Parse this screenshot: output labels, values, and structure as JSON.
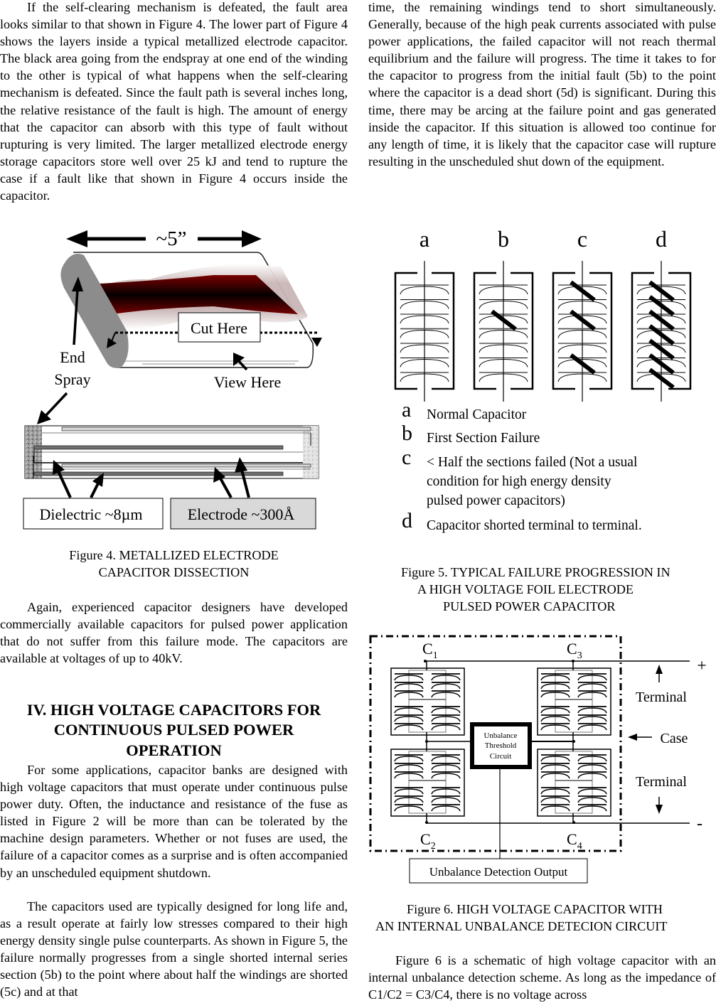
{
  "left_column": {
    "para_1": "If the self-clearing mechanism is defeated, the fault area looks similar to that shown in Figure 4. The lower part of Figure 4 shows the layers inside a typical metallized electrode capacitor.   The black area going from the endspray at one end of the winding to the other is typical of what happens when the self-clearing mechanism is defeated.   Since the fault path is several inches long, the relative resistance of the fault is high. The amount of energy that the capacitor can absorb with this type of fault without rupturing is very limited.   The larger metallized electrode energy storage capacitors store well over 25 kJ and tend to rupture the case if a fault like that shown in Figure 4 occurs inside the capacitor.",
    "para_2": "Again, experienced capacitor designers have developed commercially available capacitors for pulsed power application that do not suffer from this failure mode. The capacitors are available at voltages of up to 40kV.",
    "section_heading_line1": "IV. HIGH VOLTAGE CAPACITORS  FOR",
    "section_heading_line2": "CONTINUOUS PULSED POWER",
    "section_heading_line3": "OPERATION",
    "para_3": "For some applications, capacitor banks are designed with high voltage capacitors that must operate under continuous pulse power duty.   Often, the inductance and resistance of the fuse as listed in Figure 2 will be more than can be tolerated by the machine design parameters. Whether or not fuses are used, the failure of a capacitor comes as a surprise and is often accompanied by an unscheduled equipment shutdown.",
    "para_4": "The capacitors used are typically designed for long life and, as a result operate at fairly low stresses compared to their high energy density single pulse counterparts.   As shown in Figure 5, the failure normally progresses from a single shorted internal series section (5b) to the point where about half the windings are shorted (5c) and at that"
  },
  "figure_4": {
    "length_label": "~5”",
    "cut_label": "Cut Here",
    "end_spray_line1": "End",
    "end_spray_line2": "Spray",
    "view_label": "View Here",
    "dielectric_label": "Dielectric ~8µm",
    "electrode_label": "Electrode ~300Å",
    "caption_line1": "Figure 4.  METALLIZED ELECTRODE",
    "caption_line2": "CAPACITOR DISSECTION",
    "colors": {
      "fault": "#7a0000",
      "endspray": "#8c8c8c",
      "electrode_box": "#d9d9d9"
    }
  },
  "right_column": {
    "para_1": "time, the remaining windings tend to short simultaneously. Generally, because of the high peak currents associated with pulse power applications, the failed capacitor will not reach thermal equilibrium and the failure will progress. The time it takes to for the capacitor to progress from the initial fault (5b) to the point where the capacitor is a dead short (5d) is significant.  During this time, there may be arcing at the failure point and gas generated inside the capacitor.   If this situation is allowed too continue for any length of time, it is likely that the capacitor case will rupture resulting in the unscheduled shut down of the equipment.",
    "para_2": "Figure 6 is a schematic of high voltage capacitor with an internal unbalance detection scheme.   As long as the impedance of C1/C2 = C3/C4, there is no voltage across"
  },
  "figure_5": {
    "panels": [
      {
        "letter": "a",
        "shorted_sections": []
      },
      {
        "letter": "b",
        "shorted_sections": [
          2
        ]
      },
      {
        "letter": "c",
        "shorted_sections": [
          0,
          2,
          5
        ]
      },
      {
        "letter": "d",
        "shorted_sections": [
          0,
          1,
          2,
          3,
          4,
          5,
          6
        ]
      }
    ],
    "legend": [
      {
        "letter": "a",
        "text": "Normal Capacitor"
      },
      {
        "letter": "b",
        "text": "First Section Failure"
      },
      {
        "letter": "c",
        "text_line1": "< Half the sections failed (Not a usual",
        "text_line2": "condition for high energy density",
        "text_line3": "pulsed power capacitors)"
      },
      {
        "letter": "d",
        "text": "Capacitor shorted terminal to terminal."
      }
    ],
    "caption_line1": "Figure 5. TYPICAL FAILURE PROGRESSION IN",
    "caption_line2": "A HIGH VOLTAGE FOIL ELECTRODE",
    "caption_line3": "PULSED POWER CAPACITOR"
  },
  "figure_6": {
    "c1": "C",
    "c1_sub": "1",
    "c2": "C",
    "c2_sub": "2",
    "c3": "C",
    "c3_sub": "3",
    "c4": "C",
    "c4_sub": "4",
    "plus": "+",
    "minus": "-",
    "terminal_top": "Terminal",
    "terminal_bottom": "Terminal",
    "case_label": "Case",
    "threshold_line1": "Unbalance",
    "threshold_line2": "Threshold",
    "threshold_line3": "Circuit",
    "output_label": "Unbalance Detection Output",
    "caption_line1": "Figure 6. HIGH VOLTAGE CAPACITOR WITH",
    "caption_line2": "AN INTERNAL UNBALANCE DETECION CIRCUIT"
  }
}
